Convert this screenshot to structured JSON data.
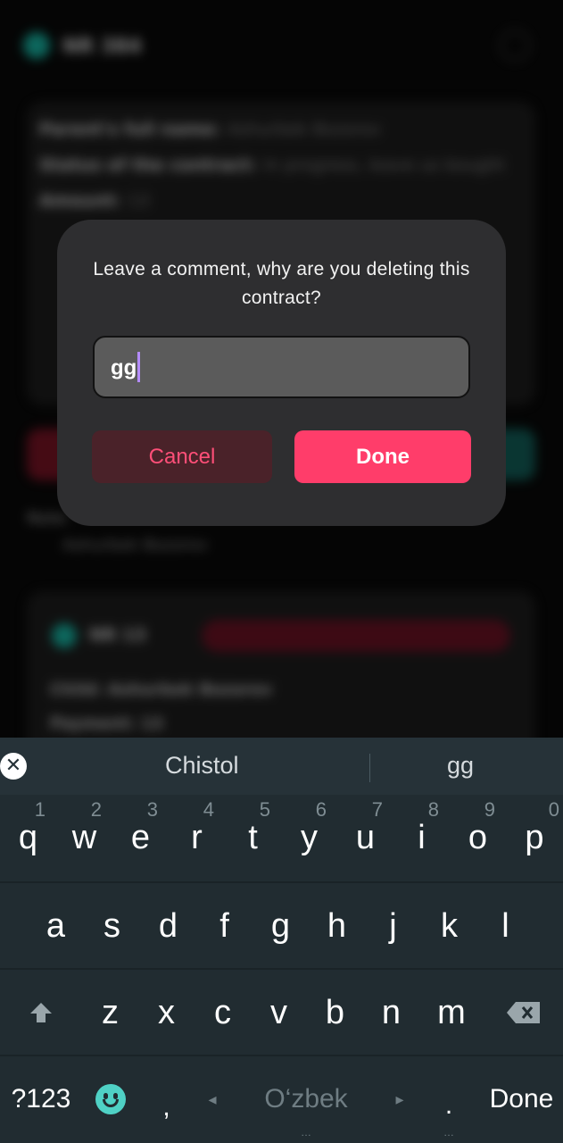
{
  "background": {
    "header_title": "NR 384",
    "card_lines": [
      {
        "label": "Parent's full name:",
        "value": "Ashurbek Bozorov"
      },
      {
        "label": "Status of the contract:",
        "value": "In progress, leave us bought"
      },
      {
        "label": "Amount:",
        "value": "13"
      }
    ],
    "note_label": "Note:",
    "note_value": "Ashurbek Bozorov",
    "card2_title": "NR 13",
    "card2_line1": "Child: Ashurbek Bozorov",
    "card2_line2": "Payment: 13"
  },
  "dialog": {
    "title": "Leave a comment, why are you deleting this contract?",
    "input_value": "gg",
    "cancel_label": "Cancel",
    "done_label": "Done"
  },
  "keyboard": {
    "suggestions": [
      "Chistol",
      "gg"
    ],
    "row1": [
      {
        "key": "q",
        "hint": "1"
      },
      {
        "key": "w",
        "hint": "2"
      },
      {
        "key": "e",
        "hint": "3"
      },
      {
        "key": "r",
        "hint": "4"
      },
      {
        "key": "t",
        "hint": "5"
      },
      {
        "key": "y",
        "hint": "6"
      },
      {
        "key": "u",
        "hint": "7"
      },
      {
        "key": "i",
        "hint": "8"
      },
      {
        "key": "o",
        "hint": "9"
      },
      {
        "key": "p",
        "hint": "0"
      }
    ],
    "row2": [
      "a",
      "s",
      "d",
      "f",
      "g",
      "h",
      "j",
      "k",
      "l"
    ],
    "row3": [
      "z",
      "x",
      "c",
      "v",
      "b",
      "n",
      "m"
    ],
    "symbols_label": "?123",
    "comma_label": ",",
    "space_label": "O‘zbek",
    "period_label": ".",
    "done_label": "Done",
    "colors": {
      "accent": "#4fd1c5",
      "background": "#263238"
    }
  },
  "icons": [
    "close-circle-icon",
    "shift-icon",
    "backspace-icon",
    "emoji-icon",
    "arrow-left-icon",
    "arrow-right-icon"
  ]
}
